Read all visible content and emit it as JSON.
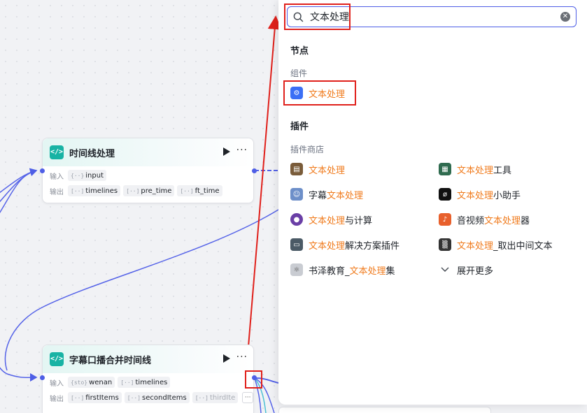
{
  "nodes": {
    "timeline": {
      "title": "时间线处理",
      "input_label": "输入",
      "output_label": "输出",
      "inputs": [
        {
          "glyph": "{··}",
          "name": "input"
        }
      ],
      "outputs": [
        {
          "glyph": "[··]",
          "name": "timelines"
        },
        {
          "glyph": "[··]",
          "name": "pre_time"
        },
        {
          "glyph": "[··]",
          "name": "ft_time"
        }
      ]
    },
    "subtitle": {
      "title": "字幕口播合并时间线",
      "input_label": "输入",
      "output_label": "输出",
      "inputs": [
        {
          "glyph": "{sto}",
          "name": "wenan"
        },
        {
          "glyph": "[··]",
          "name": "timelines"
        }
      ],
      "outputs": [
        {
          "glyph": "[··]",
          "name": "firstItems"
        },
        {
          "glyph": "[··]",
          "name": "secondItems"
        },
        {
          "glyph": "[··]",
          "name": "thirdIte"
        }
      ],
      "more": "···"
    }
  },
  "search": {
    "value": "文本处理",
    "sections": {
      "nodes": "节点",
      "components": "组件",
      "plugins": "插件",
      "plugin_store": "插件商店"
    },
    "component_results": [
      {
        "highlight": "文本处理",
        "rest": "",
        "icon": "component-icon",
        "color": "#3b6ff5"
      }
    ],
    "plugin_results_left": [
      {
        "pre": "",
        "highlight": "文本处理",
        "rest": "",
        "icon": "scroll-icon",
        "color": "#7a5c3a"
      },
      {
        "pre": "字幕",
        "highlight": "文本处理",
        "rest": "",
        "icon": "avatar-icon",
        "color": "#6d8fc9"
      },
      {
        "pre": "",
        "highlight": "文本处理",
        "rest": "与计算",
        "icon": "planet-icon",
        "color": "#6a3fa6"
      },
      {
        "pre": "",
        "highlight": "文本处理",
        "rest": "解决方案插件",
        "icon": "monitor-icon",
        "color": "#4b5a66"
      },
      {
        "pre": "书泽教育_",
        "highlight": "文本处理",
        "rest": "集",
        "icon": "atom-icon",
        "color": "#c9ccd2"
      }
    ],
    "plugin_results_right": [
      {
        "pre": "",
        "highlight": "文本处理",
        "rest": "工具",
        "icon": "book-cover-icon",
        "color": "#2f6b4f"
      },
      {
        "pre": "",
        "highlight": "文本处理",
        "rest": "小助手",
        "icon": "circle-slash-icon",
        "color": "#111111"
      },
      {
        "pre": "音视频",
        "highlight": "文本处理",
        "rest": "器",
        "icon": "note-icon",
        "color": "#e8602c"
      },
      {
        "pre": "",
        "highlight": "文本处理",
        "rest": "_取出中间文本",
        "icon": "noise-icon",
        "color": "#333333"
      }
    ],
    "show_more": "展开更多"
  },
  "colors": {
    "accent": "#4e5ee6",
    "highlight": "#f07b1d",
    "annotation": "#e0201b",
    "node_icon": "#18b3a4"
  }
}
